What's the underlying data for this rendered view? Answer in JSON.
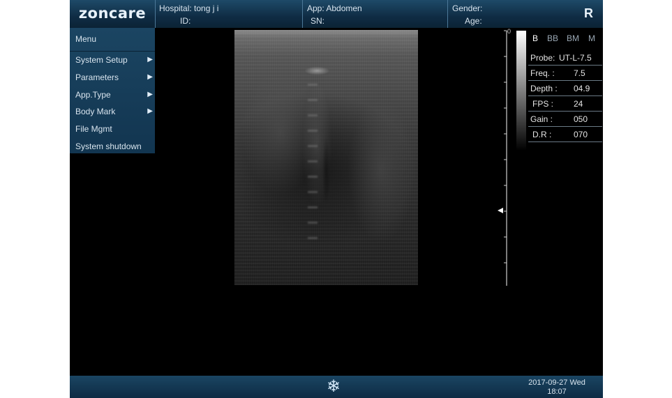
{
  "header": {
    "logo": "zoncare",
    "hospital_label": "Hospital:",
    "hospital_value": "tong j i",
    "id_label": "ID:",
    "app_label": "App:",
    "app_value": "Abdomen",
    "sn_label": "SN:",
    "gender_label": "Gender:",
    "age_label": "Age:",
    "orientation": "R"
  },
  "menu": {
    "title": "Menu",
    "items": [
      {
        "label": "System Setup",
        "arrow": "▶"
      },
      {
        "label": "Parameters",
        "arrow": "▶"
      },
      {
        "label": "App.Type",
        "arrow": "▶"
      },
      {
        "label": "Body Mark",
        "arrow": "▶"
      },
      {
        "label": "File Mgmt"
      },
      {
        "label": "System shutdown"
      }
    ]
  },
  "depth_scale": {
    "zero": "0"
  },
  "modes": [
    "B",
    "BB",
    "BM",
    "M"
  ],
  "params": [
    {
      "label": "Probe:",
      "value": "UT-L-7.5"
    },
    {
      "label": "Freq. :",
      "value": "7.5"
    },
    {
      "label": "Depth :",
      "value": "04.9"
    },
    {
      "label": "FPS  :",
      "value": "24"
    },
    {
      "label": "Gain  :",
      "value": "050"
    },
    {
      "label": "D.R  :",
      "value": "070"
    }
  ],
  "footer": {
    "freeze_icon": "snowflake-icon",
    "date": "2017-09-27 Wed",
    "time": "18:07"
  },
  "colors": {
    "panel_blue": "#123550",
    "active_mode": "#ffffff",
    "inactive_mode": "#9aa8b4"
  }
}
